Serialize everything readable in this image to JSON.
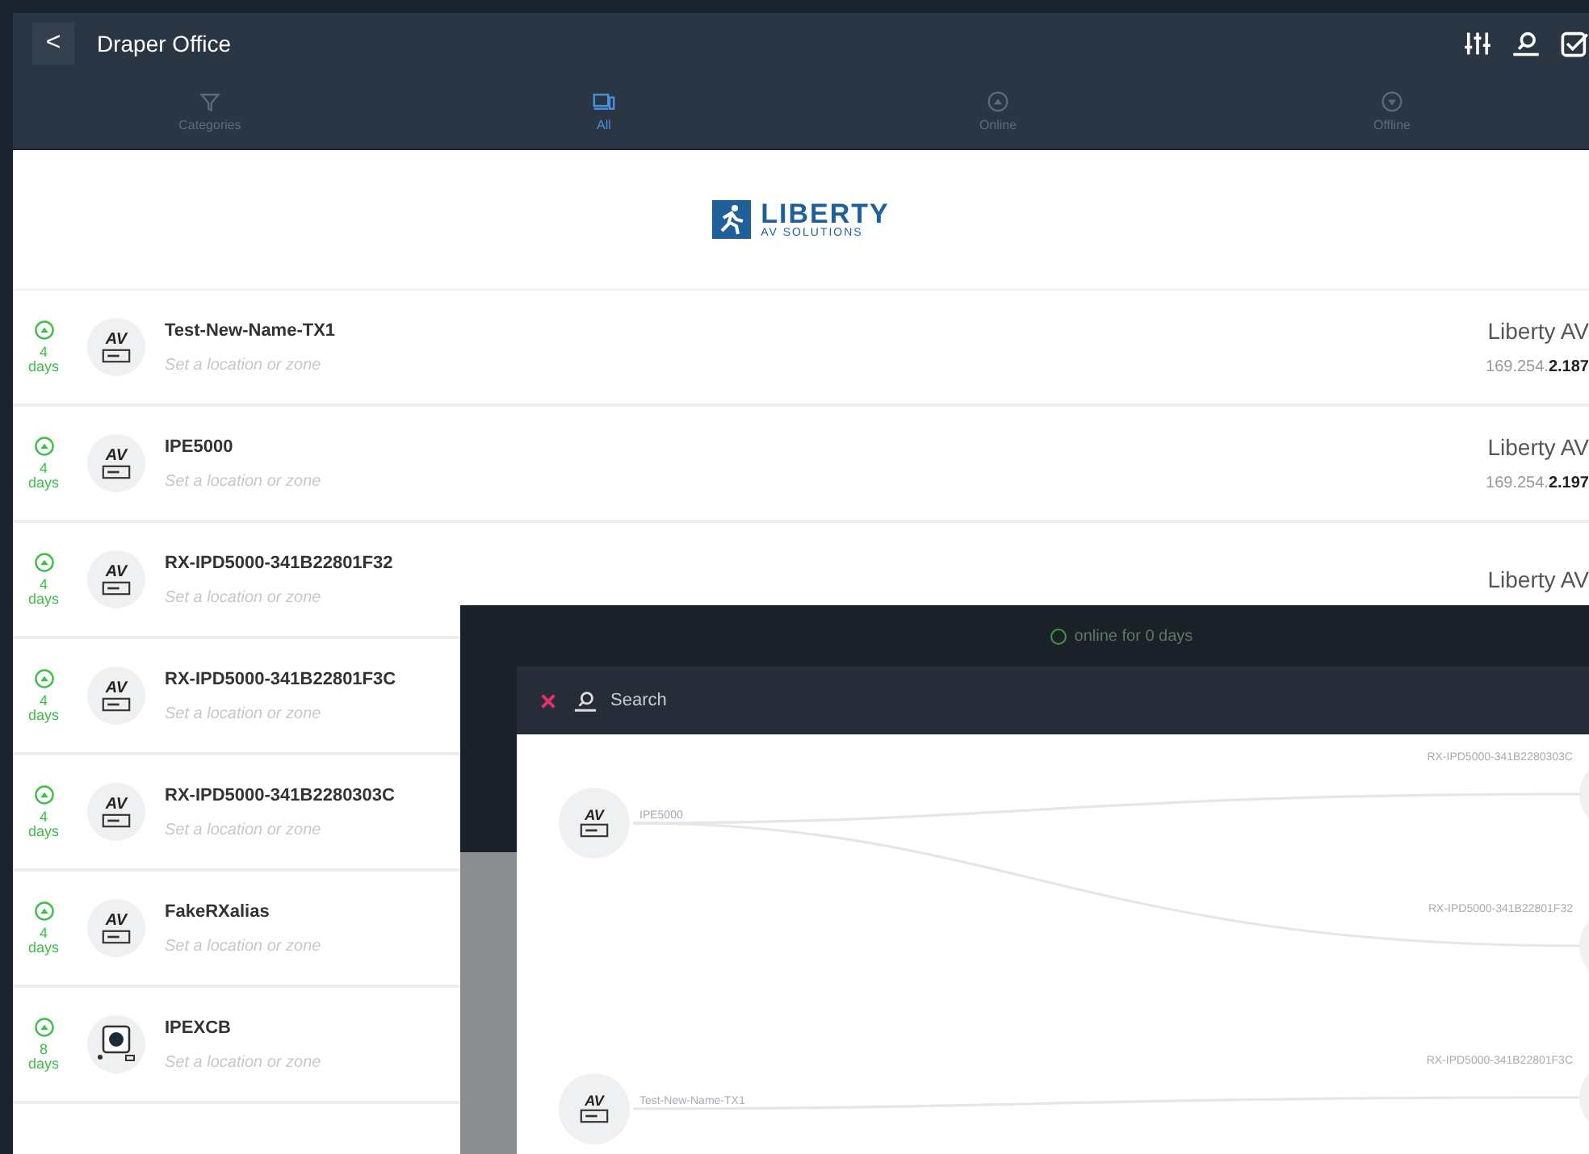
{
  "header": {
    "back": "<",
    "title": "Draper Office"
  },
  "tabs": [
    {
      "label": "Categories",
      "selected": false
    },
    {
      "label": "All",
      "selected": true
    },
    {
      "label": "Online",
      "selected": false
    },
    {
      "label": "Offline",
      "selected": false
    }
  ],
  "logo": {
    "name": "LIBERTY",
    "subtitle": "AV SOLUTIONS"
  },
  "devices": [
    {
      "kind": "av",
      "badge": "AV",
      "online": true,
      "uptime": "4",
      "unit": "days",
      "name": "Test-New-Name-TX1",
      "location": "Set a location or zone",
      "vendor": "Liberty AV",
      "ip": "169.254.**2.187**"
    },
    {
      "kind": "av",
      "badge": "AV",
      "online": true,
      "uptime": "4",
      "unit": "days",
      "name": "IPE5000",
      "location": "Set a location or zone",
      "vendor": "Liberty AV",
      "ip": "169.254.**2.197**"
    },
    {
      "kind": "av",
      "badge": "AV",
      "online": true,
      "uptime": "4",
      "unit": "days",
      "name": "RX-IPD5000-341B22801F32",
      "location": "Set a location or zone",
      "vendor": "Liberty AV"
    },
    {
      "kind": "av",
      "badge": "AV",
      "online": true,
      "uptime": "4",
      "unit": "days",
      "name": "RX-IPD5000-341B22801F3C",
      "location": "Set a location or zone"
    },
    {
      "kind": "av",
      "badge": "AV",
      "online": true,
      "uptime": "4",
      "unit": "days",
      "name": "RX-IPD5000-341B2280303C",
      "location": "Set a location or zone"
    },
    {
      "kind": "av",
      "badge": "AV",
      "online": true,
      "uptime": "4",
      "unit": "days",
      "name": "FakeRXalias",
      "location": "Set a location or zone"
    },
    {
      "kind": "camera",
      "online": true,
      "uptime": "8",
      "unit": "days",
      "name": "IPEXCB",
      "location": "Set a location or zone"
    }
  ],
  "overlay": {
    "status": "online for 0 days",
    "search": {
      "placeholder": "Search"
    },
    "graph": {
      "sources": [
        {
          "badge": "AV",
          "label": "IPE5000",
          "children": [
            {
              "label": "RX-IPD5000-341B2280303C"
            },
            {
              "label": "RX-IPD5000-341B22801F32"
            }
          ]
        },
        {
          "badge": "AV",
          "label": "Test-New-Name-TX1",
          "children": [
            {
              "label": "RX-IPD5000-341B22801F3C"
            }
          ]
        }
      ]
    }
  }
}
